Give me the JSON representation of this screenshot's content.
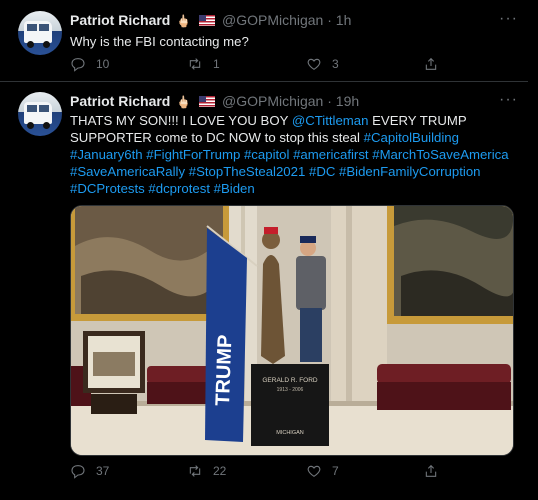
{
  "tweets": [
    {
      "name": "Patriot Richard",
      "name_suffix_emoji": "🖕🏻",
      "handle": "@GOPMichigan",
      "sep": "·",
      "time": "1h",
      "text": "Why is the FBI contacting me?",
      "replies": "10",
      "retweets": "1",
      "likes": "3"
    },
    {
      "name": "Patriot Richard",
      "name_suffix_emoji": "🖕🏻",
      "handle": "@GOPMichigan",
      "sep": "·",
      "time": "19h",
      "text_part1": "THATS MY SON!!! I LOVE YOU BOY ",
      "mention": "@CTittleman",
      "text_part2": " EVERY TRUMP SUPPORTER come to DC NOW to stop this steal ",
      "hashtags_line1": "#CapitolBuilding #January6th",
      "hashtags_rest": "#FightForTrump #capitol #americafirst #MarchToSaveAmerica #SaveAmericaRally #StopTheSteal2021 #DC #BidenFamilyCorruption #DCProtests #dcprotest #Biden",
      "replies": "37",
      "retweets": "22",
      "likes": "7",
      "statue_plaque": "GERALD R. FORD",
      "statue_years": "1913 - 2006",
      "statue_state": "MICHIGAN",
      "flag_text": "TRUMP"
    }
  ],
  "icons": {
    "more": "more-icon",
    "reply": "reply-icon",
    "retweet": "retweet-icon",
    "like": "like-icon",
    "share": "share-icon"
  }
}
